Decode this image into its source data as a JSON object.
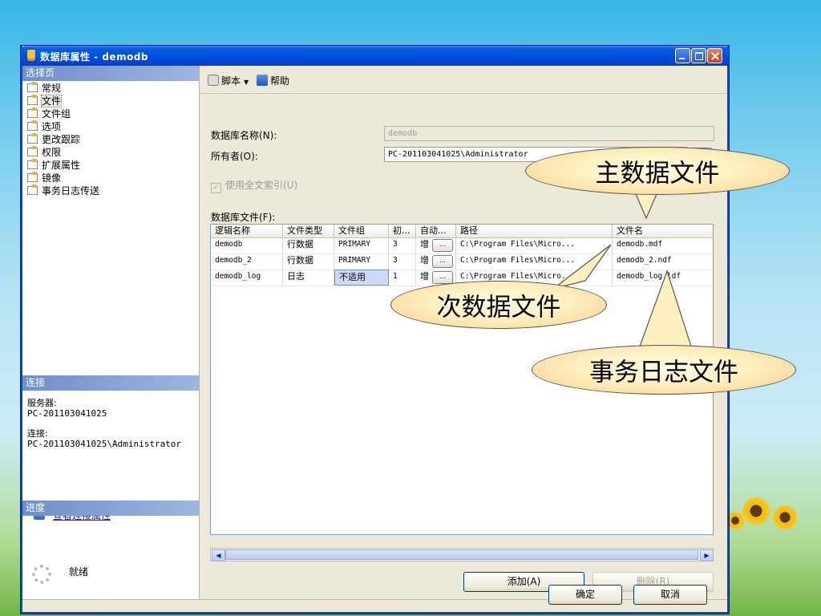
{
  "window": {
    "title": "数据库属性 - demodb"
  },
  "left_pane": {
    "select_page_header": "选择页",
    "pages": [
      {
        "label": "常规",
        "selected": false
      },
      {
        "label": "文件",
        "selected": true
      },
      {
        "label": "文件组",
        "selected": false
      },
      {
        "label": "选项",
        "selected": false
      },
      {
        "label": "更改跟踪",
        "selected": false
      },
      {
        "label": "权限",
        "selected": false
      },
      {
        "label": "扩展属性",
        "selected": false
      },
      {
        "label": "镜像",
        "selected": false
      },
      {
        "label": "事务日志传送",
        "selected": false
      }
    ],
    "connection_header": "连接",
    "server_label": "服务器:",
    "server_value": "PC-201103041025",
    "connection_label": "连接:",
    "connection_value": "PC-201103041025\\Administrator",
    "view_link": "查看连接属性",
    "progress_header": "进度",
    "progress_status": "就绪"
  },
  "toolbar": {
    "script_label": "脚本",
    "help_label": "帮助"
  },
  "form": {
    "db_name_label": "数据库名称(N):",
    "db_name_value": "demodb",
    "owner_label": "所有者(O):",
    "owner_value": "PC-201103041025\\Administrator",
    "owner_button": "...",
    "fulltext_label": "使用全文索引(U)",
    "fulltext_checked": true,
    "files_label": "数据库文件(F):"
  },
  "grid": {
    "headers": [
      "逻辑名称",
      "文件类型",
      "文件组",
      "初...",
      "自动...",
      "路径",
      "文件名"
    ],
    "rows": [
      {
        "logical": "demodb",
        "type": "行数据",
        "group": "PRIMARY",
        "init": "3",
        "auto": "增",
        "path": "C:\\Program Files\\Micro...",
        "file": "demodb.mdf"
      },
      {
        "logical": "demodb_2",
        "type": "行数据",
        "group": "PRIMARY",
        "init": "3",
        "auto": "增",
        "path": "C:\\Program Files\\Micro...",
        "file": "demodb_2.ndf"
      },
      {
        "logical": "demodb_log",
        "type": "日志",
        "group": "不适用",
        "init": "1",
        "auto": "增",
        "path": "C:\\Program Files\\Micro...",
        "file": "demodb_log.ldf"
      }
    ],
    "cell_button": "..."
  },
  "buttons": {
    "add": "添加(A)",
    "remove": "删除(R)",
    "ok": "确定",
    "cancel": "取消"
  },
  "callouts": {
    "primary": "主数据文件",
    "secondary": "次数据文件",
    "log": "事务日志文件"
  },
  "colors": {
    "titlebar": "#0050e0",
    "section_header": "#6f8fc9",
    "callout_fill": "#fff0c0"
  }
}
